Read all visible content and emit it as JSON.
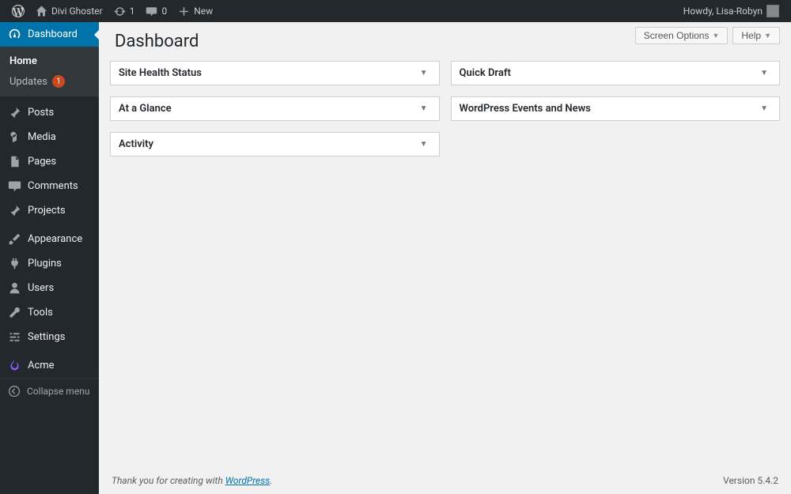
{
  "adminbar": {
    "site_name": "Divi Ghoster",
    "refresh_count": "1",
    "comments_count": "0",
    "new_label": "New",
    "howdy": "Howdy, Lisa-Robyn"
  },
  "topbar": {
    "screen_options": "Screen Options",
    "help": "Help"
  },
  "page": {
    "title": "Dashboard"
  },
  "sidebar": {
    "dashboard": "Dashboard",
    "submenu": {
      "home": "Home",
      "updates": "Updates",
      "updates_count": "1"
    },
    "posts": "Posts",
    "media": "Media",
    "pages": "Pages",
    "comments": "Comments",
    "projects": "Projects",
    "appearance": "Appearance",
    "plugins": "Plugins",
    "users": "Users",
    "tools": "Tools",
    "settings": "Settings",
    "acme": "Acme",
    "collapse": "Collapse menu"
  },
  "boxes": {
    "left": [
      {
        "title": "Site Health Status"
      },
      {
        "title": "At a Glance"
      },
      {
        "title": "Activity"
      }
    ],
    "right": [
      {
        "title": "Quick Draft"
      },
      {
        "title": "WordPress Events and News"
      }
    ]
  },
  "footer": {
    "thank_prefix": "Thank you for creating with ",
    "link": "WordPress",
    "suffix": ".",
    "version": "Version 5.4.2"
  }
}
